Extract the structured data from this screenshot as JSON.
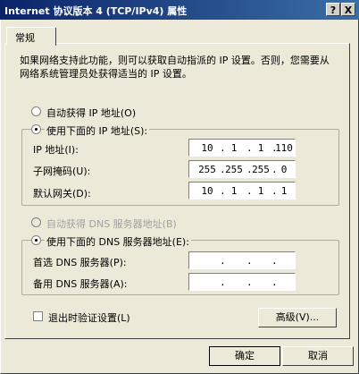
{
  "window": {
    "title": "Internet 协议版本 4 (TCP/IPv4) 属性",
    "help": "?",
    "close": "X"
  },
  "tab": {
    "label": "常规"
  },
  "description": "如果网络支持此功能，则可以获取自动指派的 IP 设置。否则，您需要从网络系统管理员处获得适当的 IP 设置。",
  "ip": {
    "auto_label": "自动获得 IP 地址(O)",
    "manual_label": "使用下面的 IP 地址(S):",
    "address_label": "IP 地址(I):",
    "address": [
      "10",
      "1",
      "1",
      "110"
    ],
    "mask_label": "子网掩码(U):",
    "mask": [
      "255",
      "255",
      "255",
      "0"
    ],
    "gateway_label": "默认网关(D):",
    "gateway": [
      "10",
      "1",
      "1",
      "1"
    ]
  },
  "dns": {
    "auto_label": "自动获得 DNS 服务器地址(B)",
    "manual_label": "使用下面的 DNS 服务器地址(E):",
    "preferred_label": "首选 DNS 服务器(P):",
    "preferred": [
      "",
      "",
      "",
      ""
    ],
    "alternate_label": "备用 DNS 服务器(A):",
    "alternate": [
      "",
      "",
      "",
      ""
    ]
  },
  "validate_label": "退出时验证设置(L)",
  "advanced_label": "高级(V)...",
  "ok_label": "确定",
  "cancel_label": "取消"
}
